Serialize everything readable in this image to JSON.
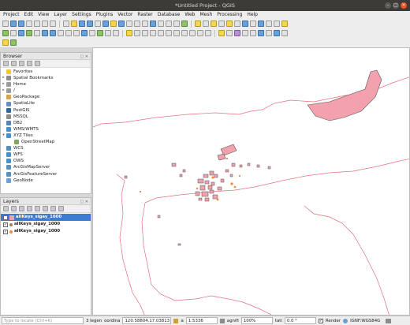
{
  "window": {
    "title": "*Untitled Project - QGIS"
  },
  "menu": [
    "Project",
    "Edit",
    "View",
    "Layer",
    "Settings",
    "Plugins",
    "Vector",
    "Raster",
    "Database",
    "Web",
    "Mesh",
    "Processing",
    "Help"
  ],
  "browser": {
    "title": "Browser",
    "items": [
      {
        "label": "Favorites",
        "exp": "",
        "color": "#f4c542"
      },
      {
        "label": "Spatial Bookmarks",
        "exp": "▸",
        "color": "#8c8c8c"
      },
      {
        "label": "Home",
        "exp": "▸",
        "color": "#9c9c9c"
      },
      {
        "label": "/",
        "exp": "▸",
        "color": "#9c9c9c"
      },
      {
        "label": "GeoPackage",
        "exp": "",
        "color": "#d9a44a"
      },
      {
        "label": "SpatiaLite",
        "exp": "",
        "color": "#6b8fbf"
      },
      {
        "label": "PostGIS",
        "exp": "",
        "color": "#336791"
      },
      {
        "label": "MSSQL",
        "exp": "",
        "color": "#8d8d8d"
      },
      {
        "label": "DB2",
        "exp": "",
        "color": "#5a7fbf"
      },
      {
        "label": "WMS/WMTS",
        "exp": "",
        "color": "#4a90c2"
      },
      {
        "label": "XYZ Tiles",
        "exp": "▾",
        "color": "#4a90c2"
      },
      {
        "label": "OpenStreetMap",
        "exp": "",
        "color": "#7fa85d",
        "indent": true
      },
      {
        "label": "WCS",
        "exp": "",
        "color": "#4a90c2"
      },
      {
        "label": "WFS",
        "exp": "",
        "color": "#4a90c2"
      },
      {
        "label": "OWS",
        "exp": "",
        "color": "#4a90c2"
      },
      {
        "label": "ArcGisMapServer",
        "exp": "",
        "color": "#5b8fbf"
      },
      {
        "label": "ArcGisFeatureServer",
        "exp": "",
        "color": "#5b8fbf"
      },
      {
        "label": "GeoNode",
        "exp": "",
        "color": "#6aa0d8"
      }
    ]
  },
  "layers": {
    "title": "Layers",
    "items": [
      {
        "label": "allKeys_sigay_1000",
        "selected": true,
        "symbol": "#f2a1ad"
      },
      {
        "label": "allKeys_sigay_1000",
        "selected": false,
        "symbol": "#a97a54"
      },
      {
        "label": "allKeys_sigay_1000",
        "selected": false,
        "symbol": "#f08a3c"
      }
    ]
  },
  "status": {
    "locate_placeholder": "Type to locate (Ctrl+K)",
    "legend_text": "3 legen",
    "coord_label": "oordina",
    "coordinate": "120.58804,17.03813",
    "scale_label": "a",
    "scale": "1:5336",
    "magnifier_label": "agnifi",
    "magnifier": "100%",
    "rotation_label": "tati",
    "rotation": "0.0 °",
    "render_label": "Render",
    "crs": "IGNF:WGS84G"
  },
  "colors": {
    "feature_fill": "#f2a1ad",
    "feature_stroke": "#555555",
    "line_color": "#e3707c",
    "point_color": "#f08a3c",
    "selection": "#3a7ccf"
  }
}
